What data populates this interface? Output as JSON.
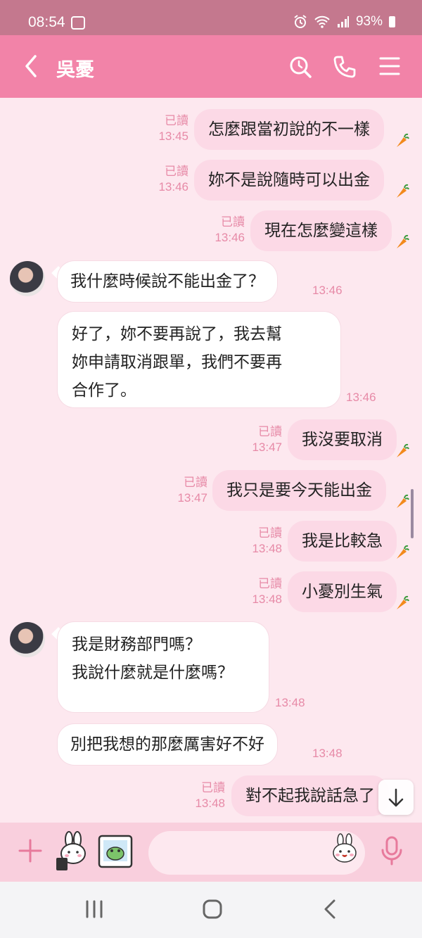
{
  "status_bar": {
    "time": "08:54",
    "battery": "93%"
  },
  "header": {
    "title": "吳憂"
  },
  "messages": [
    {
      "side": "sent",
      "read": "已讀",
      "time": "13:45",
      "text": "怎麼跟當初說的不一樣"
    },
    {
      "side": "sent",
      "read": "已讀",
      "time": "13:46",
      "text": "妳不是說隨時可以出金"
    },
    {
      "side": "sent",
      "read": "已讀",
      "time": "13:46",
      "text": "現在怎麼變這樣"
    },
    {
      "side": "recv",
      "time": "13:46",
      "text": "我什麼時候說不能出金了？"
    },
    {
      "side": "recv",
      "time": "13:46",
      "lines": [
        "好了，妳不要再說了，我去幫",
        "妳申請取消跟單，我們不要再",
        "合作了。"
      ]
    },
    {
      "side": "sent",
      "read": "已讀",
      "time": "13:47",
      "text": "我沒要取消"
    },
    {
      "side": "sent",
      "read": "已讀",
      "time": "13:47",
      "text": "我只是要今天能出金"
    },
    {
      "side": "sent",
      "read": "已讀",
      "time": "13:48",
      "text": "我是比較急"
    },
    {
      "side": "sent",
      "read": "已讀",
      "time": "13:48",
      "text": "小憂別生氣"
    },
    {
      "side": "recv",
      "time": "13:48",
      "lines": [
        "我是財務部門嗎？",
        "我說什麼就是什麼嗎？"
      ]
    },
    {
      "side": "recv",
      "time": "13:48",
      "text": "別把我想的那麼厲害好不好"
    },
    {
      "side": "sent",
      "read": "已讀",
      "time": "13:48",
      "text": "對不起我說話急了"
    }
  ],
  "input": {
    "placeholder": ""
  },
  "colors": {
    "header": "#f283a8",
    "status_bar": "#c4788e",
    "sent_bubble": "#fcd9e6",
    "background": "#fde8ef",
    "meta": "#e78aa7"
  },
  "icons": [
    "back-arrow-icon",
    "search-icon",
    "phone-icon",
    "menu-icon",
    "plus-icon",
    "sticker-icon",
    "gallery-icon",
    "emoji-icon",
    "mic-icon",
    "scroll-down-icon"
  ]
}
